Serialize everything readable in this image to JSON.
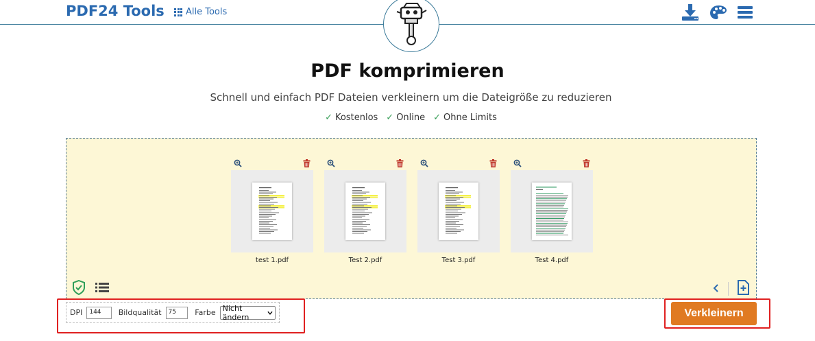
{
  "header": {
    "brand": "PDF24 Tools",
    "all_tools_label": "Alle Tools",
    "icons": [
      "download-icon",
      "palette-icon",
      "menu-icon"
    ]
  },
  "main": {
    "title": "PDF komprimieren",
    "subtitle": "Schnell und einfach PDF Dateien verkleinern um die Dateigröße zu reduzieren",
    "features": [
      "Kostenlos",
      "Online",
      "Ohne Limits"
    ]
  },
  "files": [
    {
      "name": "test 1.pdf",
      "style": "highlight"
    },
    {
      "name": "Test 2.pdf",
      "style": "highlight"
    },
    {
      "name": "Test 3.pdf",
      "style": "highlight"
    },
    {
      "name": "Test 4.pdf",
      "style": "green"
    }
  ],
  "options": {
    "dpi_label": "DPI",
    "dpi_value": "144",
    "quality_label": "Bildqualität",
    "quality_value": "75",
    "color_label": "Farbe",
    "color_value": "Nicht ändern"
  },
  "actions": {
    "compress_label": "Verkleinern"
  },
  "colors": {
    "brand": "#2b6ab0",
    "dropzone_bg": "#fdf7d6",
    "button": "#e07a22",
    "delete": "#c0392b",
    "highlight_box": "#e02020"
  }
}
